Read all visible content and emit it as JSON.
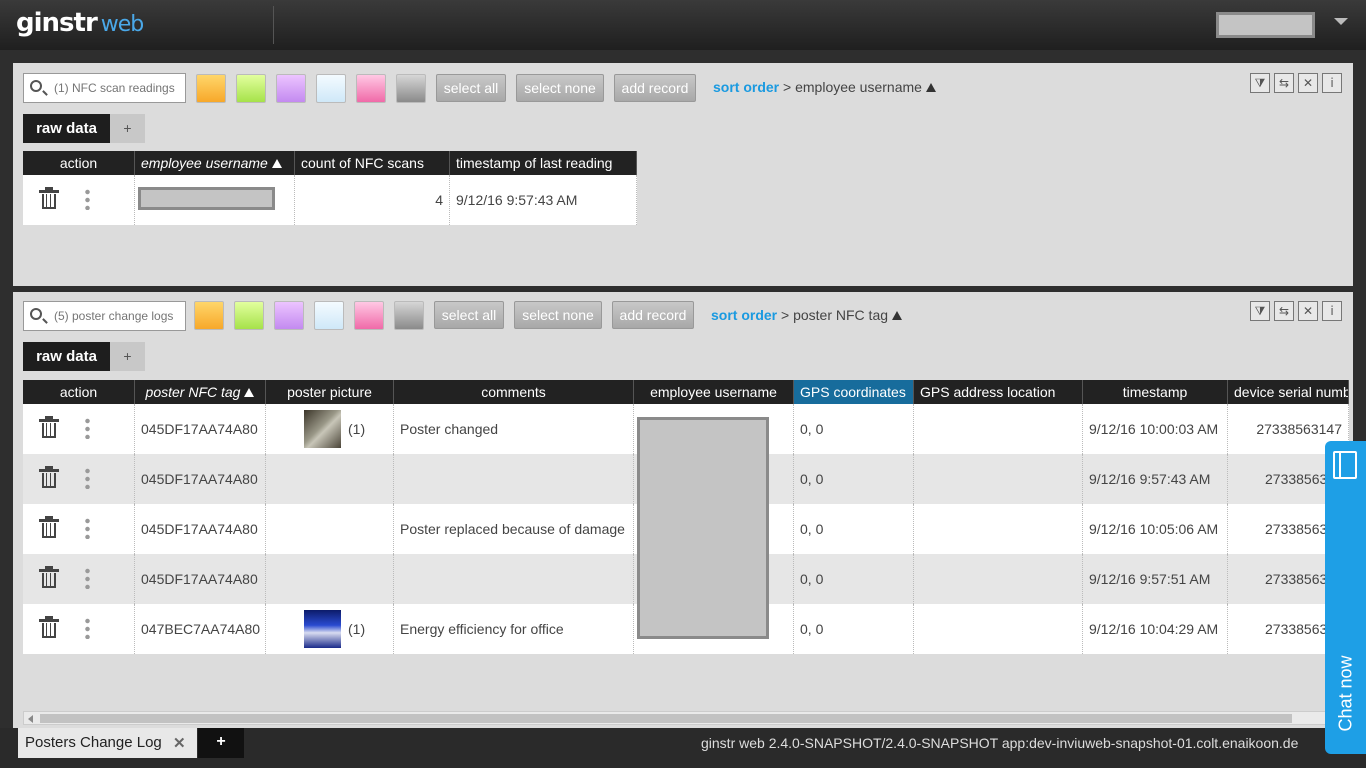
{
  "app": {
    "logo_main": "ginstr",
    "logo_sub": "web"
  },
  "panel1": {
    "search_placeholder": "(1) NFC scan readings",
    "buttons": {
      "select_all": "select all",
      "select_none": "select none",
      "add_record": "add record"
    },
    "sort": {
      "label": "sort order",
      "sep": ">",
      "field": "employee username"
    },
    "tabs": {
      "raw": "raw data",
      "plus": "+"
    },
    "columns": [
      "action",
      "employee username",
      "count of NFC scans",
      "timestamp of last reading"
    ],
    "rows": [
      {
        "count": "4",
        "timestamp": "9/12/16 9:57:43 AM"
      }
    ]
  },
  "panel2": {
    "search_placeholder": "(5) poster change logs",
    "buttons": {
      "select_all": "select all",
      "select_none": "select none",
      "add_record": "add record"
    },
    "sort": {
      "label": "sort order",
      "sep": ">",
      "field": "poster NFC tag"
    },
    "tabs": {
      "raw": "raw data",
      "plus": "+"
    },
    "columns": [
      "action",
      "poster NFC tag",
      "poster picture",
      "comments",
      "employee username",
      "GPS coordinates",
      "GPS address location",
      "timestamp",
      "device serial numb"
    ],
    "rows": [
      {
        "tag": "045DF17AA74A80",
        "pic": "(1)",
        "comment": "Poster changed",
        "gps": "0, 0",
        "timestamp": "9/12/16 10:00:03 AM",
        "serial": "27338563147"
      },
      {
        "tag": "045DF17AA74A80",
        "pic": "",
        "comment": "",
        "gps": "0, 0",
        "timestamp": "9/12/16 9:57:43 AM",
        "serial": "27338563"
      },
      {
        "tag": "045DF17AA74A80",
        "pic": "",
        "comment": "Poster replaced because of damage",
        "gps": "0, 0",
        "timestamp": "9/12/16 10:05:06 AM",
        "serial": "27338563"
      },
      {
        "tag": "045DF17AA74A80",
        "pic": "",
        "comment": "",
        "gps": "0, 0",
        "timestamp": "9/12/16 9:57:51 AM",
        "serial": "27338563"
      },
      {
        "tag": "047BEC7AA74A80",
        "pic": "(1)",
        "comment": "Energy efficiency for office",
        "gps": "0, 0",
        "timestamp": "9/12/16 10:04:29 AM",
        "serial": "27338563"
      }
    ]
  },
  "bottom": {
    "tab_label": "Posters Change Log",
    "tab_close": "✕",
    "plus": "+",
    "version": "ginstr web 2.4.0-SNAPSHOT/2.4.0-SNAPSHOT app:dev-inviuweb-snapshot-01.colt.enaikoon.de"
  },
  "chat": {
    "label": "Chat now"
  },
  "tools": {
    "filter": "⧩",
    "swap": "⇆",
    "close": "✕",
    "info": "i"
  },
  "colors": {
    "accent": "#1a9ae0",
    "header": "#222222",
    "highlight_header": "#176c9c",
    "chat": "#1e9fe6"
  }
}
